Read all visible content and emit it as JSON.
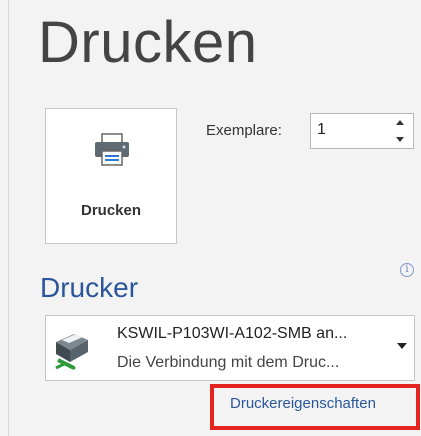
{
  "page": {
    "title": "Drucken"
  },
  "print_button": {
    "label": "Drucken",
    "icon": "printer-icon"
  },
  "copies": {
    "label": "Exemplare:",
    "value": "1"
  },
  "printer": {
    "section_title": "Drucker",
    "info_icon": "i",
    "selected_name": "KSWIL-P103WI-A102-SMB an...",
    "selected_status": "Die Verbindung mit dem Druc...",
    "properties_link": "Druckereigenschaften"
  },
  "colors": {
    "accent": "#2b579a",
    "highlight": "#e32420",
    "background": "#f3f3f3"
  }
}
